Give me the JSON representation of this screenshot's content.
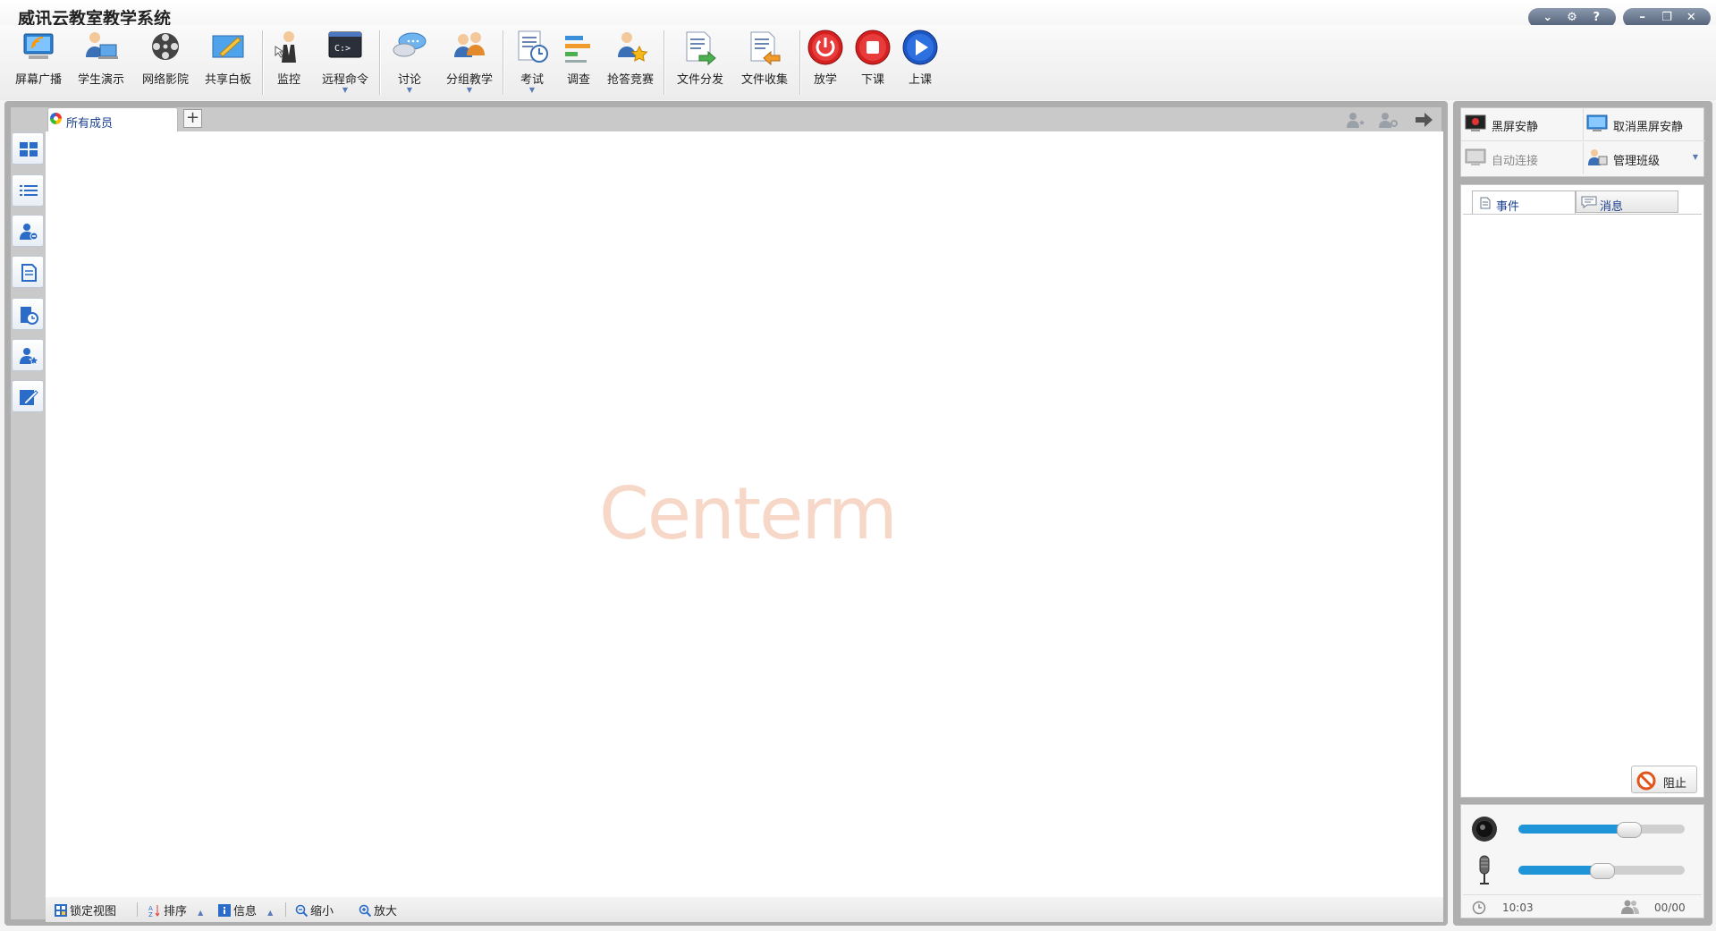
{
  "window": {
    "title": "威讯云教室教学系统",
    "buttons_left": [
      "⌄",
      "⚙",
      "?"
    ],
    "buttons_right": [
      "–",
      "❐",
      "✕"
    ]
  },
  "toolbar": {
    "items": [
      {
        "label": "屏幕广播",
        "icon": "screen-broadcast-icon"
      },
      {
        "label": "学生演示",
        "icon": "student-demo-icon"
      },
      {
        "label": "网络影院",
        "icon": "film-reel-icon"
      },
      {
        "label": "共享白板",
        "icon": "whiteboard-icon"
      },
      {
        "label": "监控",
        "icon": "monitor-person-icon"
      },
      {
        "label": "远程命令",
        "icon": "command-prompt-icon",
        "dropdown": "▼"
      },
      {
        "label": "讨论",
        "icon": "chat-bubble-icon",
        "dropdown": "▼"
      },
      {
        "label": "分组教学",
        "icon": "group-teaching-icon",
        "dropdown": "▼"
      },
      {
        "label": "考试",
        "icon": "exam-clock-icon",
        "dropdown": "▼"
      },
      {
        "label": "调查",
        "icon": "survey-bars-icon"
      },
      {
        "label": "抢答竞赛",
        "icon": "quiz-star-icon"
      },
      {
        "label": "文件分发",
        "icon": "file-distribute-icon"
      },
      {
        "label": "文件收集",
        "icon": "file-collect-icon"
      },
      {
        "label": "放学",
        "icon": "power-icon"
      },
      {
        "label": "下课",
        "icon": "stop-icon"
      },
      {
        "label": "上课",
        "icon": "play-icon"
      }
    ]
  },
  "main": {
    "tab_label": "所有成员",
    "add_tab": "+",
    "watermark": "Centerm"
  },
  "bottombar": {
    "lock_view": "锁定视图",
    "sort": "排序",
    "info": "信息",
    "zoom_out": "缩小",
    "zoom_in": "放大",
    "caret": "▲"
  },
  "right": {
    "black_screen": "黑屏安静",
    "cancel_black_screen": "取消黑屏安静",
    "auto_connect": "自动连接",
    "manage_class": "管理班级",
    "manage_caret": "▼",
    "tab_events": "事件",
    "tab_messages": "消息",
    "block": "阻止",
    "time": "10:03",
    "count": "00/00",
    "speaker_volume": 0.66,
    "mic_volume": 0.5
  },
  "colors": {
    "accent": "#1f95d8",
    "tab_text": "#1a3f8f",
    "watermark": "#f7d8c8"
  }
}
